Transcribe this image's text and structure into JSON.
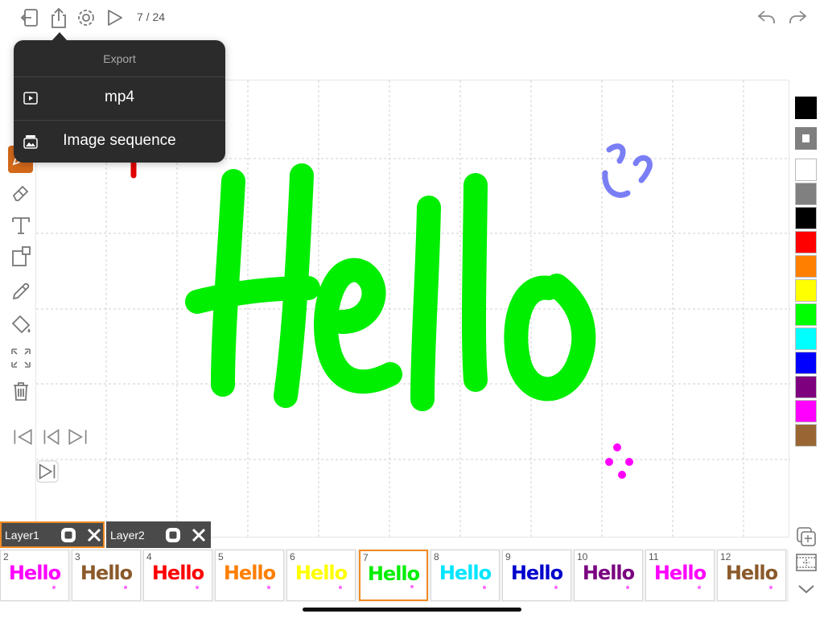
{
  "toolbar": {
    "frame_counter": "7 / 24",
    "icons": [
      "exit-icon",
      "share-icon",
      "gear-icon",
      "play-icon",
      "undo-icon",
      "redo-icon"
    ]
  },
  "export_menu": {
    "title": "Export",
    "items": [
      {
        "label": "mp4",
        "icon": "video-icon"
      },
      {
        "label": "Image sequence",
        "icon": "image-stack-icon"
      }
    ]
  },
  "canvas": {
    "text": "Hello",
    "text_color": "#00ee00"
  },
  "tools": [
    "pen-icon",
    "eraser-icon",
    "text-icon",
    "shape-icon",
    "eyedropper-icon",
    "fill-bucket-icon",
    "transform-icon",
    "trash-icon",
    "first-frame-icon",
    "prev-frame-icon",
    "next-frame-icon",
    "next-frame-add-icon"
  ],
  "palette": {
    "current": "#000000",
    "colors": [
      "#ffffff",
      "#808080",
      "#000000",
      "#ff0000",
      "#ff7f00",
      "#ffff00",
      "#00ff00",
      "#00ffff",
      "#0000ff",
      "#7f007f",
      "#ff00ff",
      "#996633"
    ]
  },
  "layers": [
    {
      "name": "Layer1",
      "active": true
    },
    {
      "name": "Layer2",
      "active": false
    }
  ],
  "frames": [
    {
      "number": "2",
      "text": "Hello",
      "color": "#ff00ff"
    },
    {
      "number": "3",
      "text": "Hello",
      "color": "#8b5a2b"
    },
    {
      "number": "4",
      "text": "Hello",
      "color": "#ff0000"
    },
    {
      "number": "5",
      "text": "Hello",
      "color": "#ff7f00"
    },
    {
      "number": "6",
      "text": "Hello",
      "color": "#ffff00"
    },
    {
      "number": "7",
      "text": "Hello",
      "color": "#00ee00",
      "selected": true
    },
    {
      "number": "8",
      "text": "Hello",
      "color": "#00e5ff"
    },
    {
      "number": "9",
      "text": "Hello",
      "color": "#0000cc"
    },
    {
      "number": "10",
      "text": "Hello",
      "color": "#7a0080"
    },
    {
      "number": "11",
      "text": "Hello",
      "color": "#ff00ff"
    },
    {
      "number": "12",
      "text": "Hello",
      "color": "#8b5a2b"
    }
  ],
  "frame_controls": [
    "onion-skin-icon",
    "add-frame-icon",
    "collapse-icon"
  ]
}
